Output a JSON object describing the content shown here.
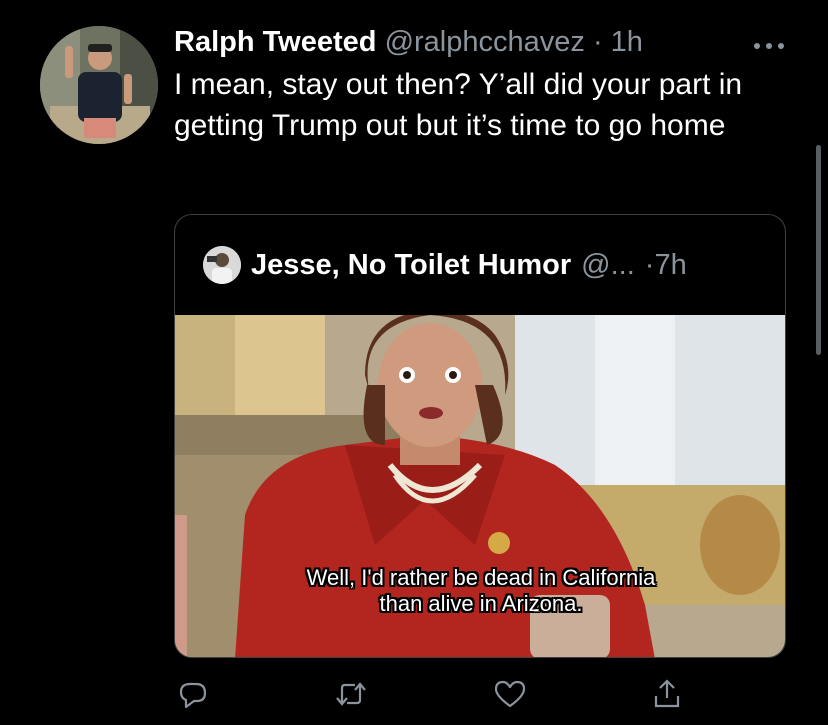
{
  "tweet": {
    "author_name": "Ralph Tweeted",
    "handle": "@ralphcchavez",
    "separator": "·",
    "time": "1h",
    "text": "I mean, stay out then? Y’all did your part in getting Trump out but it’s time to go home"
  },
  "quote": {
    "author_name": "Jesse, No Toilet Humor",
    "handle": "@...",
    "separator": "·",
    "time": "7h",
    "subtitle_line1": "Well, I'd rather be dead in California",
    "subtitle_line2": "than alive in Arizona."
  },
  "actions": {
    "icons": [
      "reply-icon",
      "retweet-icon",
      "like-icon",
      "share-icon"
    ]
  },
  "colors": {
    "background": "#000000",
    "primary_text": "#ffffff",
    "secondary_text": "#8b949c",
    "border": "#3d4144"
  }
}
